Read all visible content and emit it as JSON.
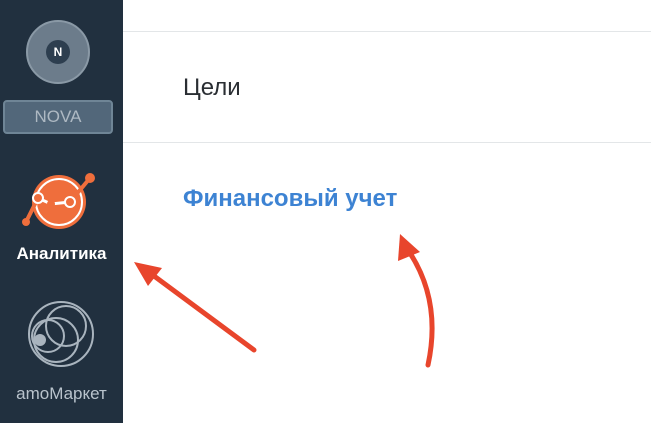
{
  "sidebar": {
    "avatar_letter": "N",
    "account_name": "NOVA",
    "items": [
      {
        "label": "Аналитика",
        "icon": "analytics-chart-icon",
        "active": true
      },
      {
        "label": "amoМаркет",
        "icon": "market-circles-icon",
        "active": false
      }
    ]
  },
  "menu": {
    "items": [
      {
        "label": "Цели"
      },
      {
        "label": "Финансовый учет",
        "highlighted": true
      }
    ]
  },
  "colors": {
    "sidebar_bg": "#21303f",
    "accent_orange": "#ef6e3c",
    "link_blue": "#3d83d3",
    "annotation_red": "#e8452c"
  }
}
